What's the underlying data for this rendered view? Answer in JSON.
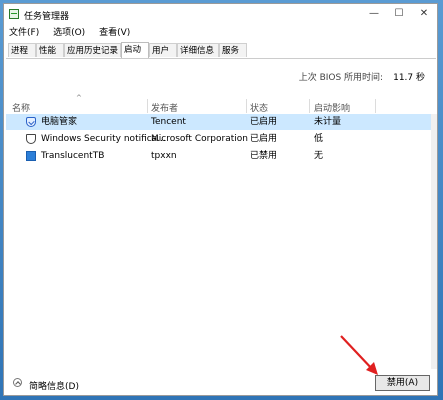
{
  "window": {
    "title": "任务管理器",
    "controls": [
      "—",
      "☐",
      "✕"
    ]
  },
  "menu": [
    "文件(F)",
    "选项(O)",
    "查看(V)"
  ],
  "tabs": [
    {
      "label": "进程"
    },
    {
      "label": "性能"
    },
    {
      "label": "应用历史记录"
    },
    {
      "label": "启动",
      "active": true
    },
    {
      "label": "用户"
    },
    {
      "label": "详细信息"
    },
    {
      "label": "服务"
    }
  ],
  "bios": {
    "label": "上次 BIOS 所用时间:",
    "value": "11.7 秒"
  },
  "columns": {
    "name": "名称",
    "publisher": "发布者",
    "status": "状态",
    "impact": "启动影响"
  },
  "rows": [
    {
      "icon": "shield-icon",
      "name": "电脑管家",
      "publisher": "Tencent",
      "status": "已启用",
      "impact": "未计量",
      "selected": true
    },
    {
      "icon": "windows-security-icon",
      "name": "Windows Security notifica...",
      "publisher": "Microsoft Corporation",
      "status": "已启用",
      "impact": "低",
      "selected": false
    },
    {
      "icon": "app-icon",
      "name": "TranslucentTB",
      "publisher": "tpxxn",
      "status": "已禁用",
      "impact": "无",
      "selected": false
    }
  ],
  "footer": {
    "less_details": "简略信息(D)",
    "disable_button": "禁用(A)"
  },
  "colors": {
    "selection": "#cce8ff",
    "arrow": "#e02020"
  }
}
